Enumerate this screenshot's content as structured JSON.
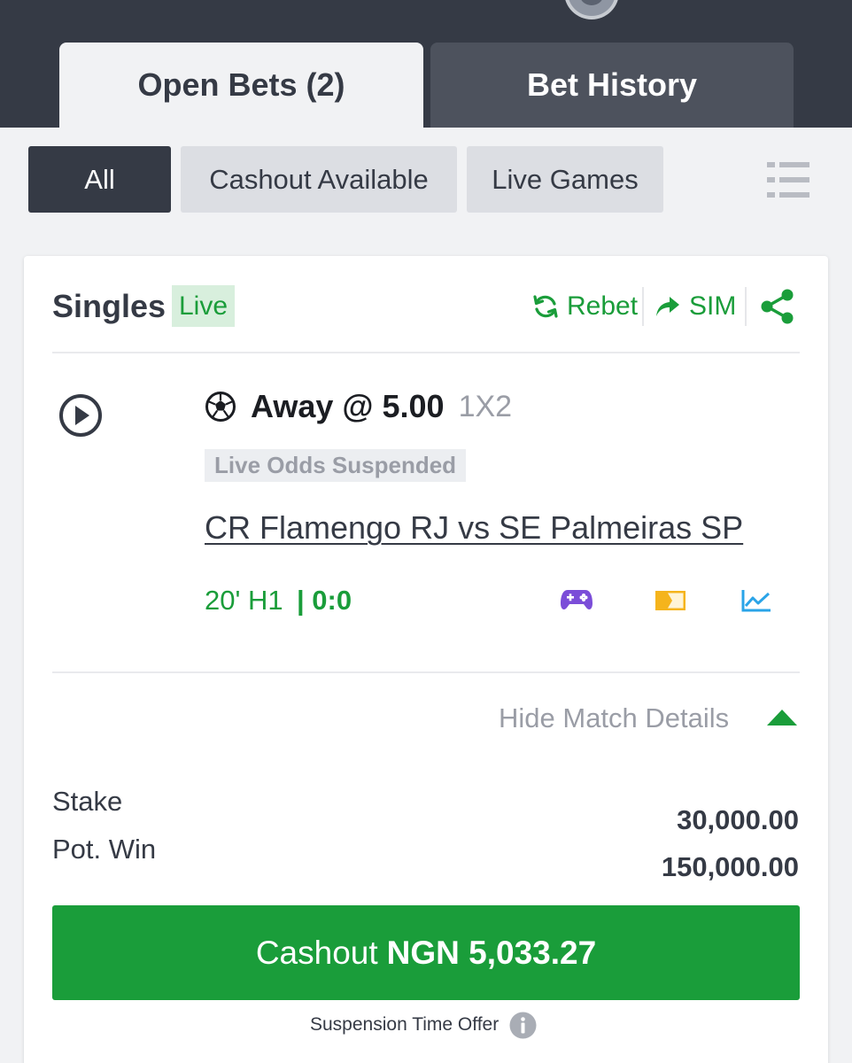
{
  "brand": {
    "name_fragment": ""
  },
  "tabs": [
    {
      "label": "Open Bets (2)",
      "active": true
    },
    {
      "label": "Bet History",
      "active": false
    }
  ],
  "filters": [
    {
      "label": "All",
      "active": true
    },
    {
      "label": "Cashout Available",
      "active": false
    },
    {
      "label": "Live Games",
      "active": false
    }
  ],
  "bet": {
    "type_label": "Singles",
    "live_badge": "Live",
    "actions": {
      "rebet": "Rebet",
      "sim": "SIM"
    },
    "selection": {
      "pick": "Away @ 5.00",
      "market": "1X2"
    },
    "status": "Live Odds Suspended",
    "match": "CR Flamengo RJ vs SE Palmeiras SP",
    "match_time": "20' H1",
    "score": "| 0:0",
    "toggle_details": "Hide Match Details",
    "stake_label": "Stake",
    "stake_value": "30,000.00",
    "potwin_label": "Pot. Win",
    "potwin_value": "150,000.00",
    "cashout": {
      "prefix": "Cashout",
      "amount": "NGN 5,033.27"
    },
    "suspension_note": "Suspension Time Offer"
  },
  "colors": {
    "accent_green": "#1a9d3a",
    "dark": "#353a45",
    "muted": "#9a9da6",
    "gamepad_purple": "#7b4dd8",
    "tv_yellow": "#f5b41c",
    "stats_blue": "#2aa4e8"
  },
  "icons": [
    "list-view-icon",
    "refresh-icon",
    "share-arrow-icon",
    "share-icon",
    "play-icon",
    "soccer-ball-icon",
    "gamepad-icon",
    "live-tv-icon",
    "stats-icon",
    "caret-up-icon",
    "info-icon"
  ]
}
